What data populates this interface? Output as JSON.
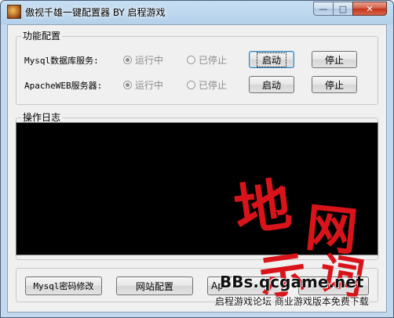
{
  "window": {
    "title": "傲视千雄一键配置器 BY 启程游戏",
    "controls": {
      "minimize": "—",
      "maximize": "□",
      "close": "✕"
    }
  },
  "function_group": {
    "title": "功能配置",
    "rows": [
      {
        "label": "Mysql数据库服务:",
        "running": "运行中",
        "stopped": "已停止",
        "running_selected": true,
        "start_label": "启动",
        "stop_label": "停止"
      },
      {
        "label": "ApacheWEB服务器:",
        "running": "运行中",
        "stopped": "已停止",
        "running_selected": true,
        "start_label": "启动",
        "stop_label": "停止"
      }
    ]
  },
  "log_group": {
    "title": "操作日志"
  },
  "bottom_buttons": {
    "mysql_password": "Mysql密码修改",
    "site_config": "网站配置",
    "partial": "Ap"
  },
  "watermark": {
    "chars": [
      "地",
      "网",
      "示",
      "词"
    ],
    "site": "BBs.qcgame.net",
    "slogan": "启程游戏论坛  商业游戏版本免费下载"
  },
  "colors": {
    "log_background": "#000000",
    "watermark_red": "#d8141a",
    "close_button": "#c2331a"
  }
}
